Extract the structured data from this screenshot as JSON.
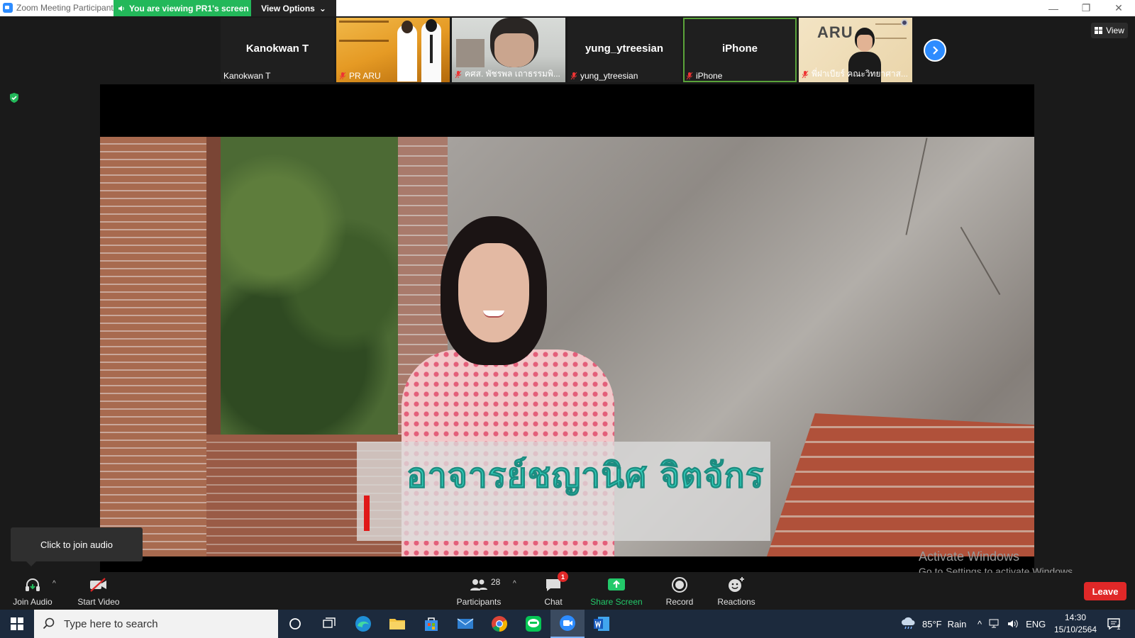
{
  "window": {
    "title": "Zoom Meeting Participant",
    "viewing_banner": "You are viewing PR1's screen",
    "view_options": "View Options"
  },
  "participants": [
    {
      "name_center": "Kanokwan T",
      "label": "Kanokwan T",
      "type": "name"
    },
    {
      "name_center": "",
      "label": "PR ARU",
      "type": "image-pr"
    },
    {
      "name_center": "",
      "label": "คศส. พัชรพล เถาธรรมพิ...",
      "type": "camera"
    },
    {
      "name_center": "yung_ytreesian",
      "label": "yung_ytreesian",
      "type": "name"
    },
    {
      "name_center": "iPhone",
      "label": "iPhone",
      "type": "name",
      "active": true
    },
    {
      "name_center": "",
      "label": "พี่ฝาเบียร์ คณะวิทยาศาส...",
      "type": "image-aru",
      "logo_text": "ARU"
    }
  ],
  "view_button": {
    "label": "View"
  },
  "shared_screen": {
    "caption": "อาจารย์ชญานิศ จิตจักร"
  },
  "tooltip": {
    "text": "Click to join audio"
  },
  "toolbar": {
    "join_audio": "Join Audio",
    "start_video": "Start Video",
    "participants": "Participants",
    "participant_count": "28",
    "chat": "Chat",
    "chat_badge": "1",
    "share_screen": "Share Screen",
    "record": "Record",
    "reactions": "Reactions",
    "leave": "Leave"
  },
  "watermark": {
    "line1": "Activate Windows",
    "line2": "Go to Settings to activate Windows."
  },
  "taskbar": {
    "search_placeholder": "Type here to search",
    "weather_temp": "85°F",
    "weather_text": "Rain",
    "language": "ENG",
    "time": "14:30",
    "date": "15/10/2564",
    "notification_count": "1"
  },
  "colors": {
    "zoom_blue": "#2d8cff",
    "banner_green": "#23b85a",
    "leave_red": "#e02828",
    "caption_teal": "#34d4c0"
  }
}
